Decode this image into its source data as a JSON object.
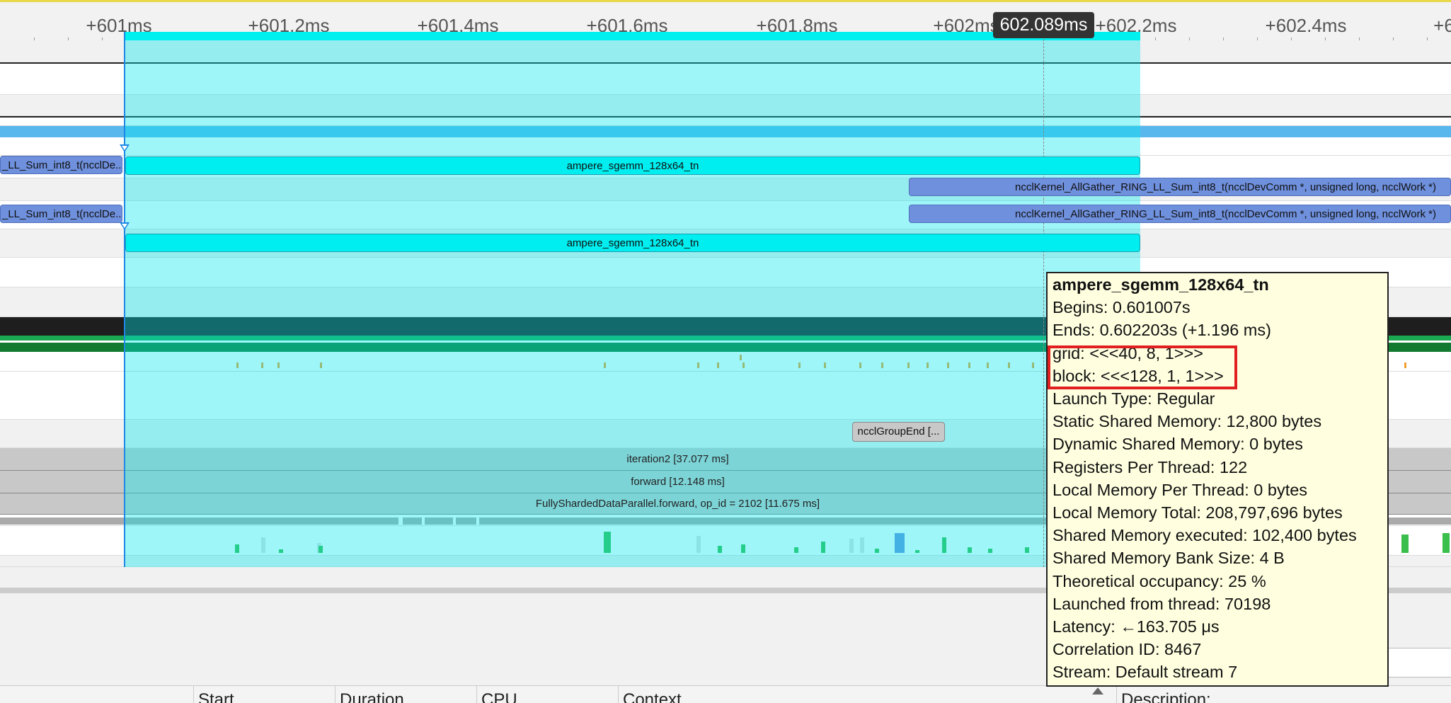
{
  "ruler": {
    "labels": [
      "+601ms",
      "+601.2ms",
      "+601.4ms",
      "+601.6ms",
      "+601.8ms",
      "+602ms",
      "+602.2ms",
      "+602.4ms",
      "+6"
    ],
    "cursor_time": "602.089ms"
  },
  "slices": {
    "row1_left": "_LL_Sum_int8_t(ncclDe...",
    "row1_main": "ampere_sgemm_128x64_tn",
    "row2_right": "ncclKernel_AllGather_RING_LL_Sum_int8_t(ncclDevComm *, unsigned long, ncclWork *)",
    "row3_left": "_LL_Sum_int8_t(ncclDe...",
    "row3_right": "ncclKernel_AllGather_RING_LL_Sum_int8_t(ncclDevComm *, unsigned long, ncclWork *)",
    "row4_main": "ampere_sgemm_128x64_tn",
    "nccl_group_end": "ncclGroupEnd [...",
    "iteration": "iteration2 [37.077 ms]",
    "forward": "forward [12.148 ms]",
    "fsdp_forward": "FullyShardedDataParallel.forward, op_id = 2102 [11.675 ms]"
  },
  "tooltip": {
    "title": "ampere_sgemm_128x64_tn",
    "lines": [
      "Begins: 0.601007s",
      "Ends: 0.602203s (+1.196 ms)",
      "grid:  <<<40, 8, 1>>>",
      "block: <<<128, 1, 1>>>",
      "Launch Type: Regular",
      "Static Shared Memory: 12,800 bytes",
      "Dynamic Shared Memory: 0 bytes",
      "Registers Per Thread: 122",
      "Local Memory Per Thread: 0 bytes",
      "Local Memory Total: 208,797,696 bytes",
      "Shared Memory executed: 102,400 bytes",
      "Shared Memory Bank Size: 4 B",
      "Theoretical occupancy: 25 %",
      "Launched from thread: 70198",
      "Latency: ←163.705 μs",
      "Correlation ID: 8467",
      "Stream: Default stream 7"
    ]
  },
  "bottom_table": {
    "columns": [
      "Start",
      "Duration",
      "CPU",
      "Context"
    ],
    "side_label": "Description:"
  },
  "colors": {
    "selection": "#00e8f0",
    "kernel": "#00eef0",
    "nccl_kernel": "#6f90dd",
    "tooltip_bg": "#ffffe0",
    "highlight": "#e02020"
  }
}
